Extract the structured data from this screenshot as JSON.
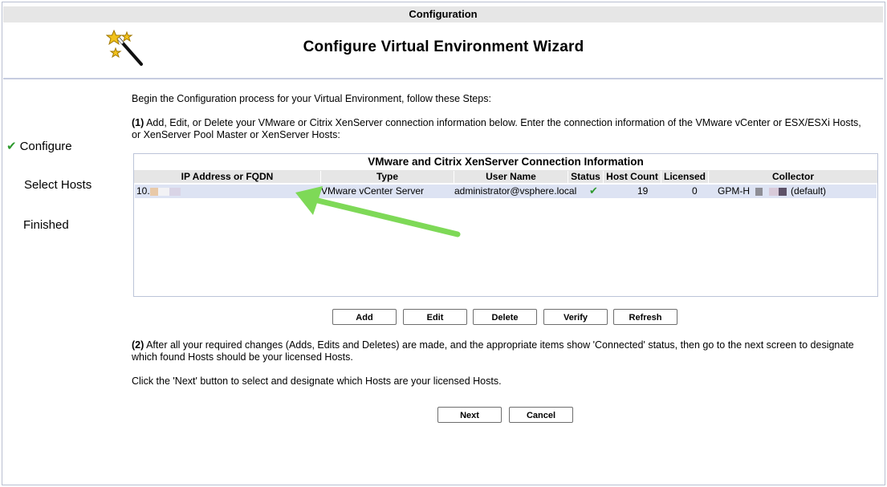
{
  "window": {
    "title": "Configuration"
  },
  "wizard": {
    "heading": "Configure Virtual Environment Wizard"
  },
  "steps": [
    {
      "label": "Configure",
      "active": true,
      "icon": "check-icon"
    },
    {
      "label": "Select Hosts",
      "active": false
    },
    {
      "label": "Finished",
      "active": false
    }
  ],
  "intro": "Begin the Configuration process for your Virtual Environment, follow these Steps:",
  "step1": {
    "number": "(1)",
    "text": "Add, Edit, or Delete your VMware or Citrix XenServer connection information below. Enter the connection information of the VMware vCenter or ESX/ESXi Hosts, or XenServer Pool Master or XenServer Hosts:"
  },
  "table": {
    "title": "VMware and Citrix XenServer Connection Information",
    "columns": [
      "IP Address or FQDN",
      "Type",
      "User Name",
      "Status",
      "Host Count",
      "Licensed",
      "Collector"
    ],
    "rows": [
      {
        "ip": "10.",
        "type": "VMware vCenter Server",
        "user": "administrator@vsphere.local",
        "status_icon": "check-icon",
        "host_count": "19",
        "licensed": "0",
        "collector_prefix": "GPM-H",
        "collector_suffix": "(default)"
      }
    ]
  },
  "buttons": {
    "add": "Add",
    "edit": "Edit",
    "delete": "Delete",
    "verify": "Verify",
    "refresh": "Refresh",
    "next": "Next",
    "cancel": "Cancel"
  },
  "step2": {
    "number": "(2)",
    "text": "After all your required changes (Adds, Edits and Deletes) are made, and the appropriate items show 'Connected' status, then go to the next screen to designate which found Hosts should be your licensed Hosts."
  },
  "instruction": "Click the 'Next' button to select and designate which Hosts are your licensed Hosts.",
  "colors": {
    "accent_green": "#2e9a2e",
    "arrow_green": "#7ed957",
    "selected_row": "#dde3f3",
    "header_bg": "#e6e6e6"
  }
}
